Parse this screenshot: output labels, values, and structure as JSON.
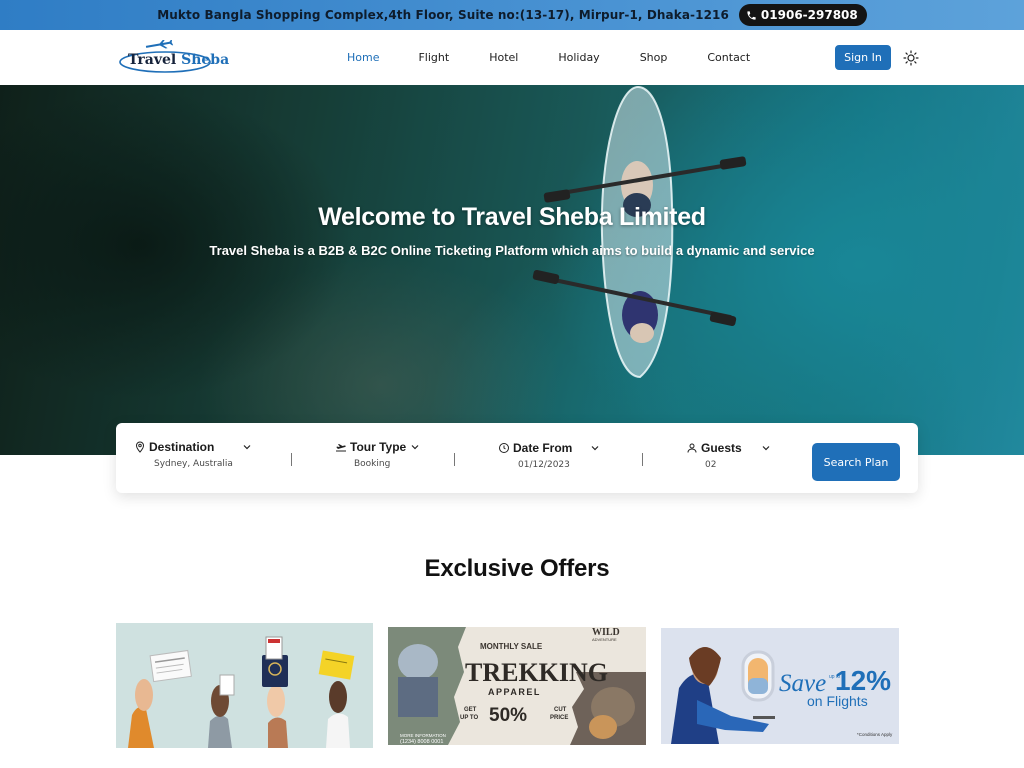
{
  "topbar": {
    "address": "Mukto Bangla Shopping Complex,4th Floor, Suite no:(13-17), Mirpur-1, Dhaka-1216",
    "phone": "01906-297808",
    "phone_icon": "phone-icon"
  },
  "brand": {
    "name_part1": "Travel ",
    "name_part2": "Sheba",
    "icon": "airplane-icon"
  },
  "nav": {
    "items": [
      {
        "label": "Home",
        "active": true
      },
      {
        "label": "Flight"
      },
      {
        "label": "Hotel"
      },
      {
        "label": "Holiday"
      },
      {
        "label": "Shop"
      },
      {
        "label": "Contact"
      }
    ],
    "signin_label": "Sign In",
    "theme_icon": "sun-icon"
  },
  "hero": {
    "title": "Welcome to Travel Sheba Limited",
    "subtitle": "Travel Sheba is a B2B & B2C Online Ticketing Platform which aims to build a dynamic and service"
  },
  "search": {
    "fields": [
      {
        "label": "Destination",
        "value": "Sydney, Australia",
        "icon": "location-pin-icon"
      },
      {
        "label": "Tour Type",
        "value": "Booking",
        "icon": "plane-takeoff-icon"
      },
      {
        "label": "Date From",
        "value": "01/12/2023",
        "icon": "clock-icon"
      },
      {
        "label": "Guests",
        "value": "02",
        "icon": "user-icon"
      }
    ],
    "button_label": "Search Plan"
  },
  "offers": {
    "title": "Exclusive Offers",
    "cards": [
      {
        "kind": "documents-hands"
      },
      {
        "kind": "trekking",
        "top_left": "MONTHLY SALE",
        "brand": "WILD",
        "brand_sub": "ADVENTURE",
        "headline": "TREKKING",
        "subline": "APPAREL",
        "get": "GET",
        "upto": "UP TO",
        "discount": "50%",
        "cut": "CUT",
        "price": "PRICE",
        "more_info": "MORE INFORMATION",
        "phone": "(1234) 8008 0001"
      },
      {
        "kind": "flights",
        "save": "Save",
        "up_to": "up to",
        "percent": "12%",
        "on_flights": "on Flights",
        "note": "*Conditions Apply"
      }
    ]
  },
  "colors": {
    "accent": "#1f6fb8",
    "topbar": "#3b86cb",
    "pill": "#141414"
  }
}
